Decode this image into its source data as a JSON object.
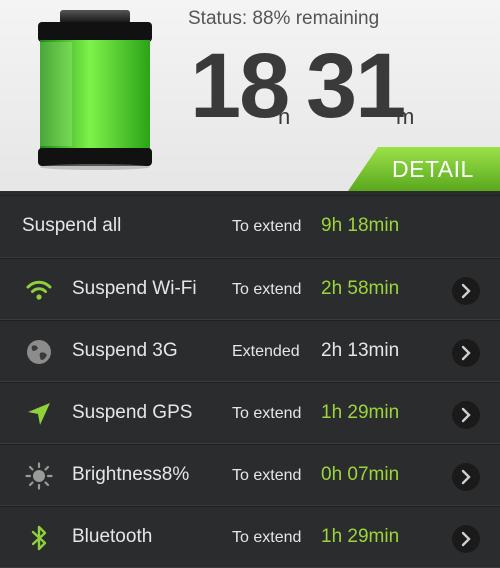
{
  "status": {
    "text": "Status: 88% remaining",
    "percent": 88
  },
  "time": {
    "hours": "18",
    "hours_unit": "h",
    "minutes": "31",
    "minutes_unit": "m"
  },
  "detail_label": "DETAIL",
  "colors": {
    "accent": "#8fd13a",
    "header_bg": "#eeeeee",
    "list_bg": "#2b2c2e"
  },
  "rows": [
    {
      "label": "Suspend all",
      "ext": "To extend",
      "value": "9h 18min",
      "icon": "",
      "highlight": true
    },
    {
      "label": "Suspend Wi-Fi",
      "ext": "To extend",
      "value": "2h 58min",
      "icon": "wifi-icon",
      "highlight": true
    },
    {
      "label": "Suspend 3G",
      "ext": "Extended",
      "value": "2h 13min",
      "icon": "globe-icon",
      "highlight": false
    },
    {
      "label": "Suspend GPS",
      "ext": "To extend",
      "value": "1h 29min",
      "icon": "location-arrow-icon",
      "highlight": true
    },
    {
      "label": "Brightness8%",
      "ext": "To extend",
      "value": "0h 07min",
      "icon": "brightness-icon",
      "highlight": true
    },
    {
      "label": "Bluetooth",
      "ext": "To extend",
      "value": "1h 29min",
      "icon": "bluetooth-icon",
      "highlight": true
    }
  ]
}
